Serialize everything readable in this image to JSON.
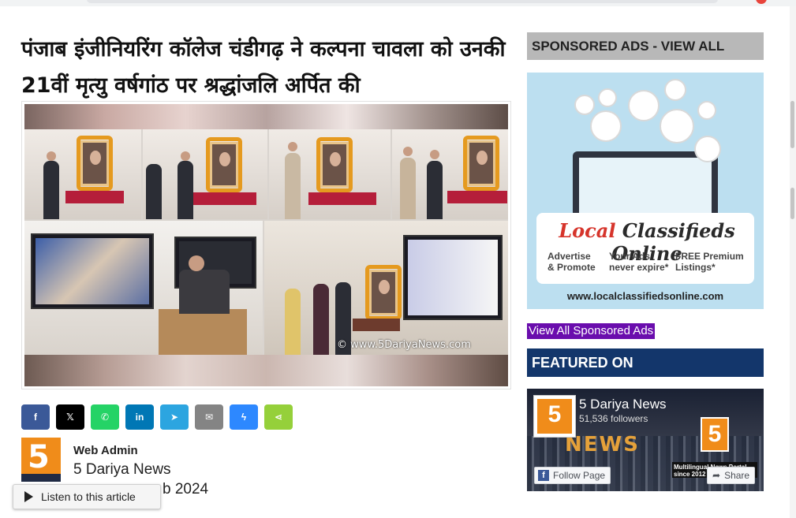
{
  "article": {
    "title": "पंजाब इंजीनियरिंग कॉलेज चंडीगढ़ ने कल्पना चावला को उनकी 21वीं मृत्यु वर्षगांठ पर श्रद्धांजलि अर्पित की",
    "image_watermark": "© www.5DariyaNews.com"
  },
  "share": {
    "buttons": [
      {
        "name": "facebook",
        "label": "f",
        "color": "#3b5998"
      },
      {
        "name": "x",
        "label": "𝕏",
        "color": "#000000"
      },
      {
        "name": "whatsapp",
        "label": "✆",
        "color": "#25d366"
      },
      {
        "name": "linkedin",
        "label": "in",
        "color": "#0077b5"
      },
      {
        "name": "telegram",
        "label": "➤",
        "color": "#2ca5e0"
      },
      {
        "name": "email",
        "label": "✉",
        "color": "#848484"
      },
      {
        "name": "messenger",
        "label": "ϟ",
        "color": "#2d88ff"
      },
      {
        "name": "sharethis",
        "label": "⋖",
        "color": "#95d03a"
      }
    ]
  },
  "author": {
    "avatar_text": "5",
    "name": "Web Admin",
    "site": "5 Dariya News",
    "date_partial": "b 2024"
  },
  "listen": {
    "label": "Listen to this article"
  },
  "sidebar": {
    "sponsored_heading": "SPONSORED ADS - VIEW ALL",
    "ad": {
      "logo_local": "Local",
      "logo_rest": " Classifieds Online",
      "col1": "Advertise\n& Promote",
      "col2": "Your Ads\nnever expire*",
      "col3": "FREE Premium\nListings*",
      "url": "www.localclassifiedsonline.com"
    },
    "view_all_link": "View All Sponsored Ads",
    "featured_heading": "FEATURED ON",
    "facebook": {
      "page_name": "5 Dariya News",
      "followers": "51,536 followers",
      "banner_word": "NEWS",
      "logo_text": "5",
      "tag": "Multilingual News Portal since 2012",
      "follow_label": "Follow Page",
      "share_label": "Share"
    }
  },
  "colors": {
    "sponsored_bg": "#b8b8b8",
    "featured_bg": "#13366b",
    "view_all_bg": "#6a0dad",
    "brand_orange": "#f08c1a"
  }
}
